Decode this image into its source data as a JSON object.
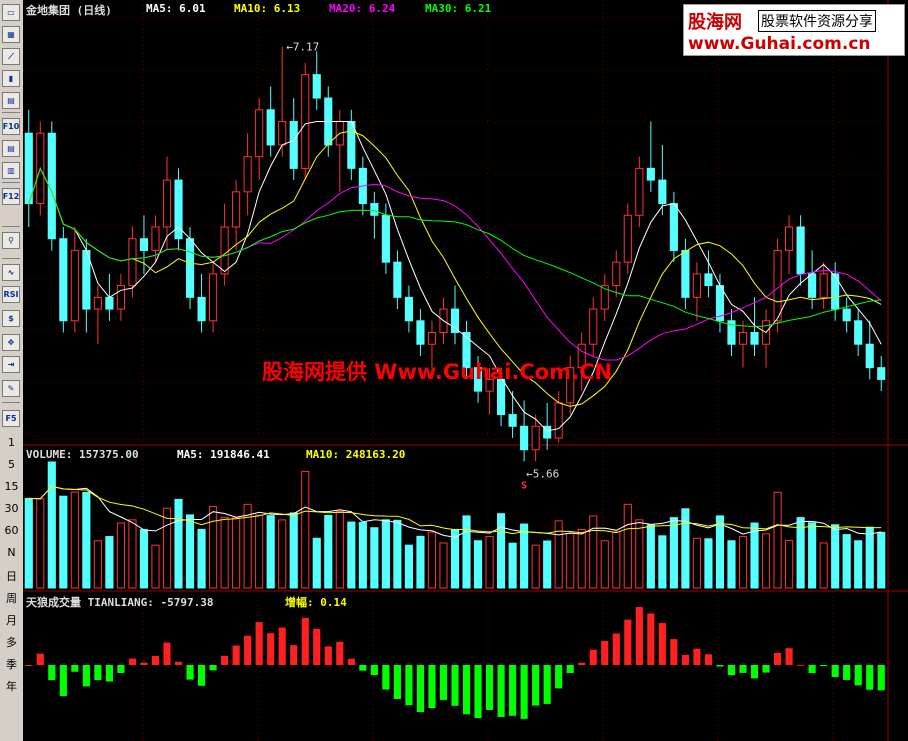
{
  "toolbar": {
    "icons": [
      "minute-chart-icon",
      "kline-icon",
      "line-chart-icon",
      "candle-icon",
      "multi-window-icon",
      "f10-icon",
      "news-icon",
      "report-icon",
      "f12-icon",
      "search-icon",
      "indicator-icon",
      "rsi-icon",
      "money-icon",
      "move-icon",
      "exit-icon",
      "pencil-icon",
      "f5-icon"
    ],
    "rsi_label": "RSI",
    "f10_label": "F10",
    "f12_label": "F12",
    "f5_label": "F5",
    "periods": [
      "1",
      "5",
      "15",
      "30",
      "60",
      "N",
      "日",
      "周",
      "月",
      "多",
      "季",
      "年"
    ]
  },
  "price_header": {
    "title": "金地集团 (日线)",
    "ma5": "MA5: 6.01",
    "ma10": "MA10: 6.13",
    "ma20": "MA20: 6.24",
    "ma30": "MA30: 6.21"
  },
  "volume_header": {
    "volume": "VOLUME: 157375.00",
    "ma5": "MA5: 191846.41",
    "ma10": "MA10: 248163.20"
  },
  "tianliang_header": {
    "name": "天狼成交量 TIANLIANG: -5797.38",
    "increase": "增幅: 0.14"
  },
  "logo": {
    "brand": "股海网",
    "tagline": "股票软件资源分享",
    "url": "www.Guhai.com.cn"
  },
  "watermark": "股海网提供 Www.Guhai.Com.CN",
  "annotations": {
    "high": "7.17",
    "low": "5.66",
    "low_marker": "S"
  },
  "colors": {
    "up": "#ff3232",
    "down": "#54ffff",
    "ma5": "#ffffff",
    "ma10": "#ffff00",
    "ma20": "#ff00ff",
    "ma30": "#00ff00",
    "tl_up": "#ff2020",
    "tl_down": "#00ff00",
    "axis": "#a00000"
  },
  "chart_data": {
    "type": "candlestick",
    "panels": [
      "price",
      "volume",
      "tianliang"
    ],
    "price_range": [
      5.5,
      7.3
    ],
    "candles": [
      [
        6.8,
        6.9,
        6.4,
        6.5
      ],
      [
        6.5,
        6.85,
        6.45,
        6.8
      ],
      [
        6.8,
        6.85,
        6.3,
        6.35
      ],
      [
        6.35,
        6.4,
        5.95,
        6.0
      ],
      [
        6.0,
        6.4,
        5.95,
        6.3
      ],
      [
        6.3,
        6.35,
        5.95,
        6.05
      ],
      [
        6.05,
        6.15,
        5.9,
        6.1
      ],
      [
        6.1,
        6.2,
        6.0,
        6.05
      ],
      [
        6.05,
        6.2,
        6.0,
        6.15
      ],
      [
        6.15,
        6.4,
        6.1,
        6.35
      ],
      [
        6.35,
        6.45,
        6.2,
        6.3
      ],
      [
        6.3,
        6.45,
        6.25,
        6.4
      ],
      [
        6.4,
        6.7,
        6.3,
        6.6
      ],
      [
        6.6,
        6.65,
        6.3,
        6.35
      ],
      [
        6.35,
        6.4,
        6.05,
        6.1
      ],
      [
        6.1,
        6.2,
        5.95,
        6.0
      ],
      [
        6.0,
        6.25,
        5.95,
        6.2
      ],
      [
        6.2,
        6.5,
        6.15,
        6.4
      ],
      [
        6.4,
        6.6,
        6.3,
        6.55
      ],
      [
        6.55,
        6.8,
        6.45,
        6.7
      ],
      [
        6.7,
        6.95,
        6.6,
        6.9
      ],
      [
        6.9,
        7.0,
        6.7,
        6.75
      ],
      [
        6.75,
        7.17,
        6.7,
        6.85
      ],
      [
        6.85,
        6.95,
        6.6,
        6.65
      ],
      [
        6.65,
        7.1,
        6.6,
        7.05
      ],
      [
        7.05,
        7.15,
        6.9,
        6.95
      ],
      [
        6.95,
        7.0,
        6.7,
        6.75
      ],
      [
        6.75,
        6.9,
        6.55,
        6.85
      ],
      [
        6.85,
        6.9,
        6.6,
        6.65
      ],
      [
        6.65,
        6.7,
        6.45,
        6.5
      ],
      [
        6.5,
        6.55,
        6.35,
        6.45
      ],
      [
        6.45,
        6.5,
        6.2,
        6.25
      ],
      [
        6.25,
        6.3,
        6.05,
        6.1
      ],
      [
        6.1,
        6.15,
        5.95,
        6.0
      ],
      [
        6.0,
        6.05,
        5.85,
        5.9
      ],
      [
        5.9,
        6.0,
        5.8,
        5.95
      ],
      [
        5.95,
        6.1,
        5.9,
        6.05
      ],
      [
        6.05,
        6.15,
        5.9,
        5.95
      ],
      [
        5.95,
        6.0,
        5.75,
        5.8
      ],
      [
        5.8,
        5.85,
        5.65,
        5.7
      ],
      [
        5.7,
        5.8,
        5.6,
        5.75
      ],
      [
        5.75,
        5.8,
        5.55,
        5.6
      ],
      [
        5.6,
        5.7,
        5.5,
        5.55
      ],
      [
        5.55,
        5.66,
        5.4,
        5.45
      ],
      [
        5.45,
        5.6,
        5.4,
        5.55
      ],
      [
        5.55,
        5.65,
        5.45,
        5.5
      ],
      [
        5.5,
        5.7,
        5.48,
        5.65
      ],
      [
        5.65,
        5.85,
        5.6,
        5.8
      ],
      [
        5.8,
        5.95,
        5.7,
        5.9
      ],
      [
        5.9,
        6.1,
        5.85,
        6.05
      ],
      [
        6.05,
        6.2,
        6.0,
        6.15
      ],
      [
        6.15,
        6.3,
        6.1,
        6.25
      ],
      [
        6.25,
        6.5,
        6.2,
        6.45
      ],
      [
        6.45,
        6.7,
        6.4,
        6.65
      ],
      [
        6.65,
        6.85,
        6.55,
        6.6
      ],
      [
        6.6,
        6.75,
        6.45,
        6.5
      ],
      [
        6.5,
        6.55,
        6.25,
        6.3
      ],
      [
        6.3,
        6.35,
        6.05,
        6.1
      ],
      [
        6.1,
        6.25,
        6.0,
        6.2
      ],
      [
        6.2,
        6.3,
        6.1,
        6.15
      ],
      [
        6.15,
        6.2,
        5.95,
        6.0
      ],
      [
        6.0,
        6.05,
        5.85,
        5.9
      ],
      [
        5.9,
        6.0,
        5.8,
        5.95
      ],
      [
        5.95,
        6.1,
        5.85,
        5.9
      ],
      [
        5.9,
        6.05,
        5.8,
        6.0
      ],
      [
        6.0,
        6.35,
        5.95,
        6.3
      ],
      [
        6.3,
        6.45,
        6.2,
        6.4
      ],
      [
        6.4,
        6.45,
        6.15,
        6.2
      ],
      [
        6.2,
        6.3,
        6.05,
        6.1
      ],
      [
        6.1,
        6.25,
        6.05,
        6.2
      ],
      [
        6.2,
        6.25,
        6.0,
        6.05
      ],
      [
        6.05,
        6.1,
        5.95,
        6.0
      ],
      [
        6.0,
        6.05,
        5.85,
        5.9
      ],
      [
        5.9,
        6.0,
        5.75,
        5.8
      ],
      [
        5.8,
        5.85,
        5.7,
        5.75
      ]
    ],
    "volume_series": [
      {
        "name": "MA5",
        "value": 191846.41
      },
      {
        "name": "MA10",
        "value": 248163.2
      }
    ],
    "latest_volume": 157375.0,
    "ma_values": {
      "MA5": 6.01,
      "MA10": 6.13,
      "MA20": 6.24,
      "MA30": 6.21
    }
  }
}
